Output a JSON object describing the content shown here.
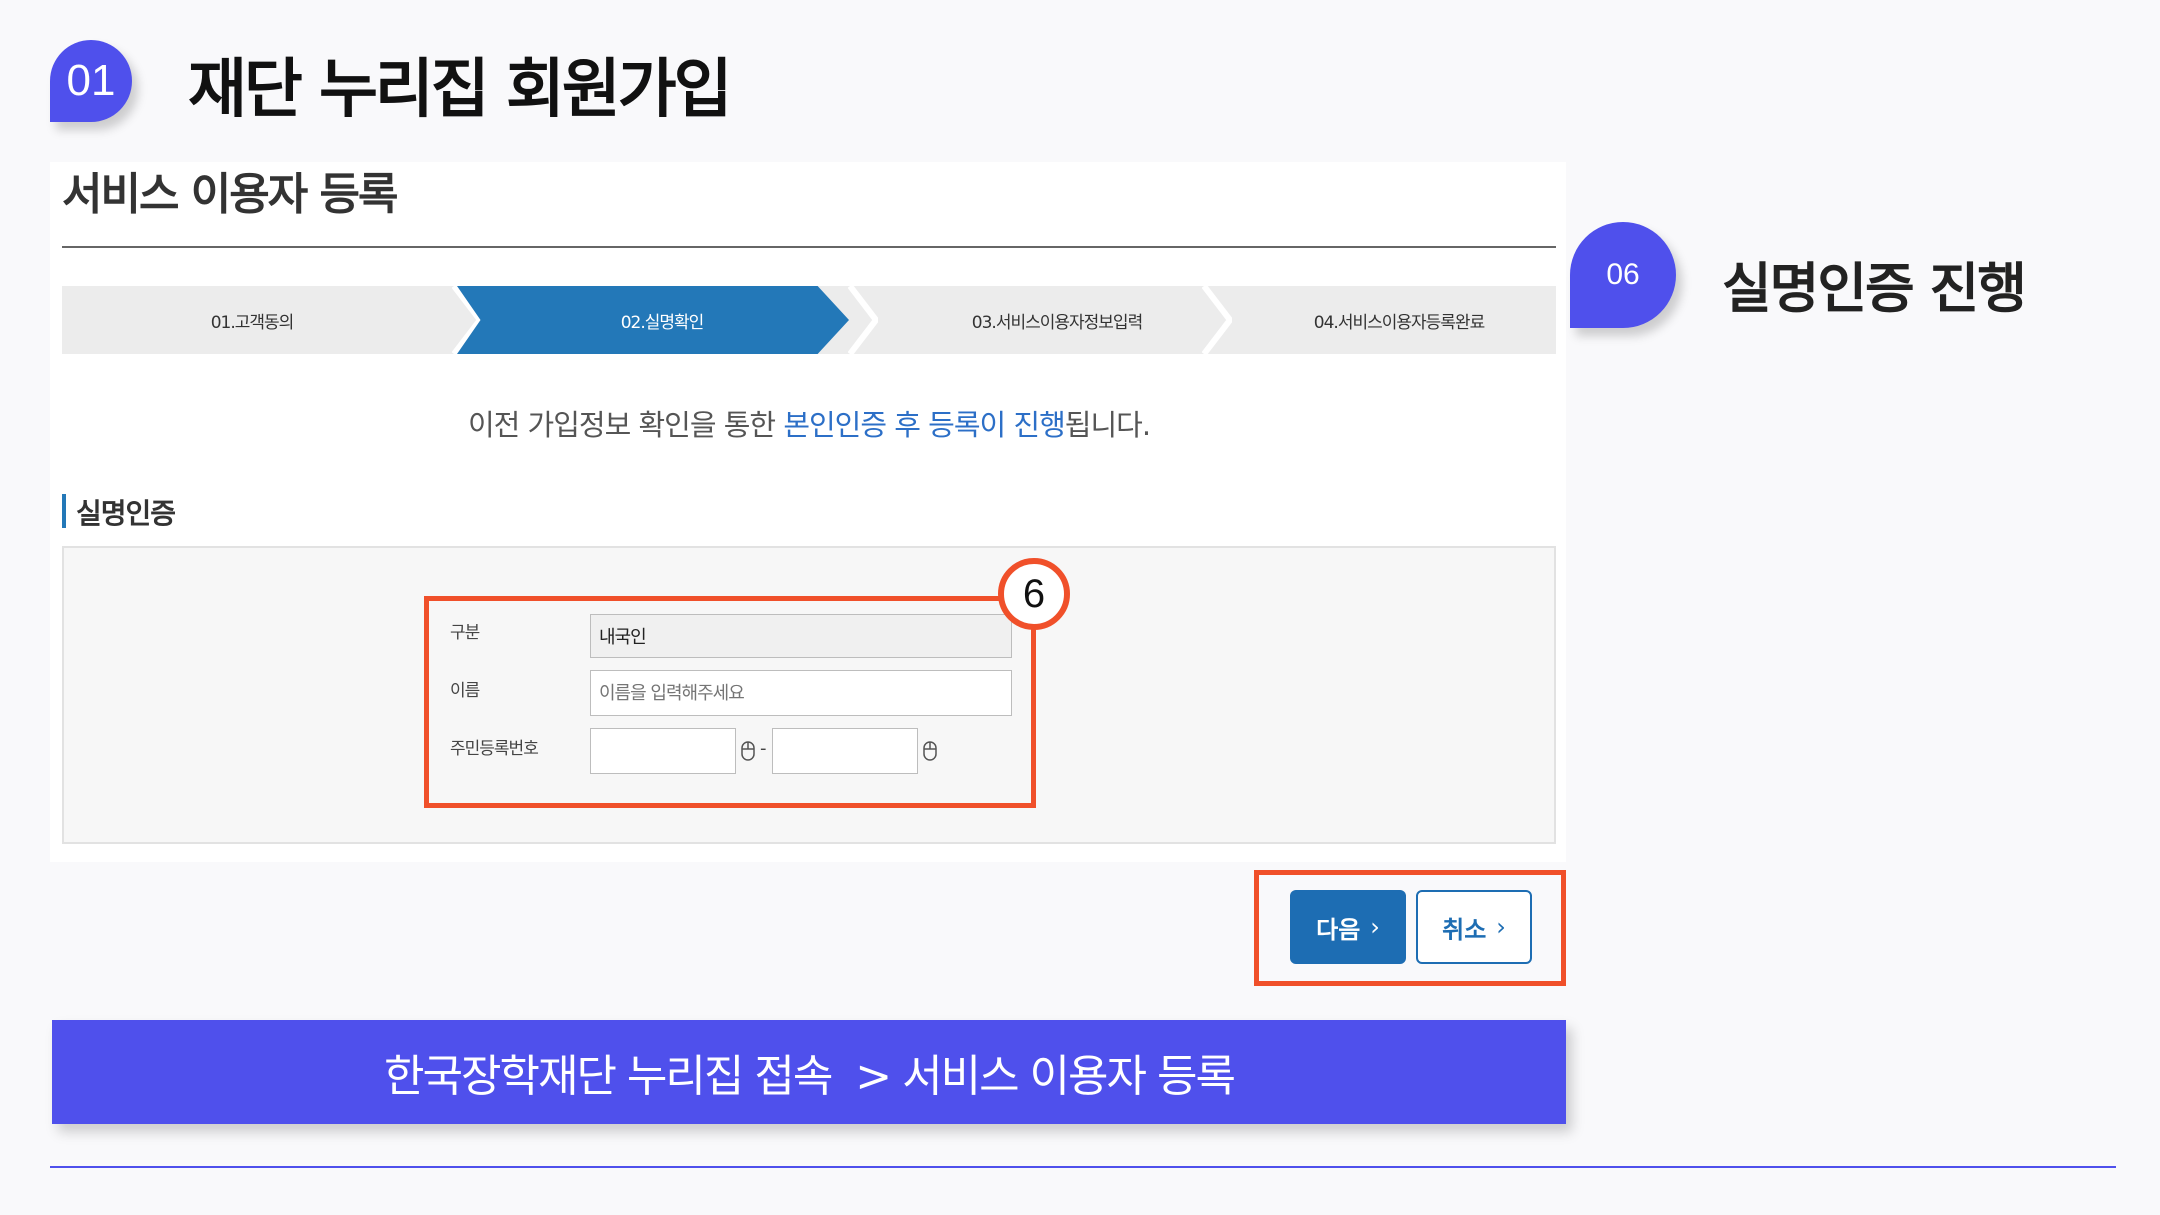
{
  "header": {
    "badge": "01",
    "title": "재단 누리집 회원가입"
  },
  "screenshot": {
    "page_title": "서비스 이용자 등록",
    "steps": [
      {
        "label": "01.고객동의"
      },
      {
        "label": "02.실명확인"
      },
      {
        "label": "03.서비스이용자정보입력"
      },
      {
        "label": "04.서비스이용자등록완료"
      }
    ],
    "notice_prefix": "이전 가입정보 확인을 통한 ",
    "notice_highlight": "본인인증 후 등록이 진행",
    "notice_suffix": "됩니다.",
    "section_title": "실명인증",
    "form": {
      "category_label": "구분",
      "category_value": "내국인",
      "name_label": "이름",
      "name_placeholder": "이름을 입력해주세요",
      "rrn_label": "주민등록번호",
      "rrn_separator": "-"
    },
    "marker": "6",
    "next_button": "다음",
    "cancel_button": "취소"
  },
  "callout": {
    "badge": "06",
    "text": "실명인증 진행"
  },
  "footer_banner": "한국장학재단 누리집 접속  > 서비스 이용자 등록",
  "colors": {
    "accent": "#4f50ec",
    "step_active": "#2378b8",
    "highlight_box": "#f0502a",
    "link_blue": "#2c6fc7"
  }
}
